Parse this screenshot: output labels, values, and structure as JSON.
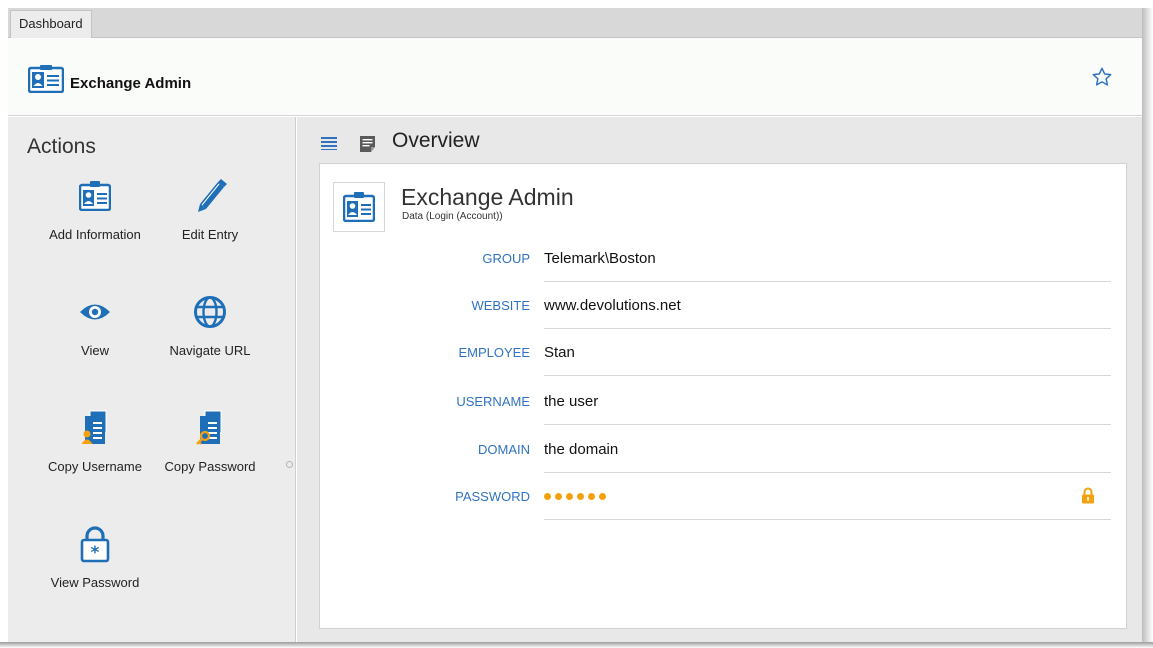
{
  "tab": {
    "label": "Dashboard"
  },
  "header": {
    "title": "Exchange Admin"
  },
  "sidebar": {
    "title": "Actions",
    "items": [
      {
        "label": "Add Information",
        "icon": "add-information-icon"
      },
      {
        "label": "Edit Entry",
        "icon": "pencil-icon"
      },
      {
        "label": "View",
        "icon": "eye-icon"
      },
      {
        "label": "Navigate URL",
        "icon": "globe-icon"
      },
      {
        "label": "Copy Username",
        "icon": "copy-username-icon"
      },
      {
        "label": "Copy Password",
        "icon": "copy-password-icon"
      },
      {
        "label": "View Password",
        "icon": "padlock-icon"
      }
    ]
  },
  "overview": {
    "title": "Overview"
  },
  "entry": {
    "title": "Exchange Admin",
    "subtitle": "Data (Login (Account))",
    "fields": [
      {
        "label": "GROUP",
        "value": "Telemark\\Boston"
      },
      {
        "label": "WEBSITE",
        "value": "www.devolutions.net"
      },
      {
        "label": "EMPLOYEE",
        "value": "Stan"
      },
      {
        "label": "USERNAME",
        "value": "the user"
      },
      {
        "label": "DOMAIN",
        "value": "the domain"
      },
      {
        "label": "PASSWORD",
        "value": "",
        "masked": true,
        "mask_length": 6
      }
    ]
  },
  "colors": {
    "accent_blue": "#2f73c0",
    "password_orange": "#f3a10f",
    "sidebar_bg": "#ececec",
    "main_bg": "#e8e8e8"
  }
}
